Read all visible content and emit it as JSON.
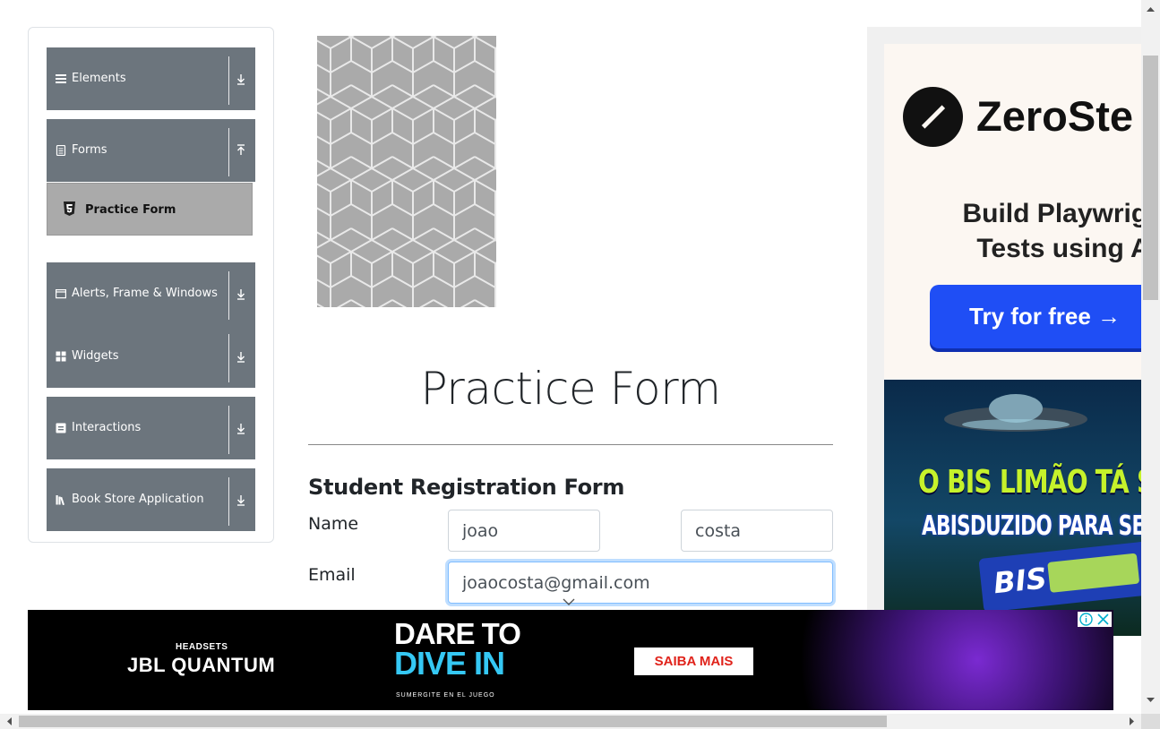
{
  "sidebar": {
    "groups": [
      {
        "label": "Elements",
        "icon": "hamburger-icon",
        "state": "collapsed"
      },
      {
        "label": "Forms",
        "icon": "form-doc-icon",
        "state": "expanded"
      },
      {
        "label": "Alerts, Frame & Windows",
        "icon": "window-icon",
        "state": "collapsed"
      },
      {
        "label": "Widgets",
        "icon": "widgets-grid-icon",
        "state": "collapsed"
      },
      {
        "label": "Interactions",
        "icon": "interactions-icon",
        "state": "collapsed"
      },
      {
        "label": "Book Store Application",
        "icon": "books-icon",
        "state": "collapsed"
      }
    ],
    "active_item": "Practice Form",
    "active_item_icon": "html5-icon",
    "group_color": "#6c757d",
    "active_color": "#aaaaaa"
  },
  "main": {
    "title": "Practice Form",
    "form_heading": "Student Registration Form",
    "fields": {
      "name_label": "Name",
      "first_name": "joao",
      "last_name": "costa",
      "email_label": "Email",
      "email": "joaocosta@gmail.com"
    },
    "focus_color": "#80bdff"
  },
  "side_ad": {
    "brand": "ZeroSte",
    "headline": "Build Playwrigh\nTests using A",
    "cta": "Try for free →",
    "cta_color": "#1f4ef5",
    "promo_line1": "O BIS LIMÃO TÁ SE",
    "promo_line2": "ABISDUZIDO PARA SEM",
    "product": "BIS"
  },
  "bottom_ad": {
    "kicker": "HEADSETS",
    "brand": "JBL QUANTUM",
    "headline1": "DARE TO",
    "headline2": "DIVE IN",
    "tagline": "SUMERGITE EN EL JUEGO",
    "cta": "SAIBA MAIS",
    "accent": "#35c8f4"
  }
}
